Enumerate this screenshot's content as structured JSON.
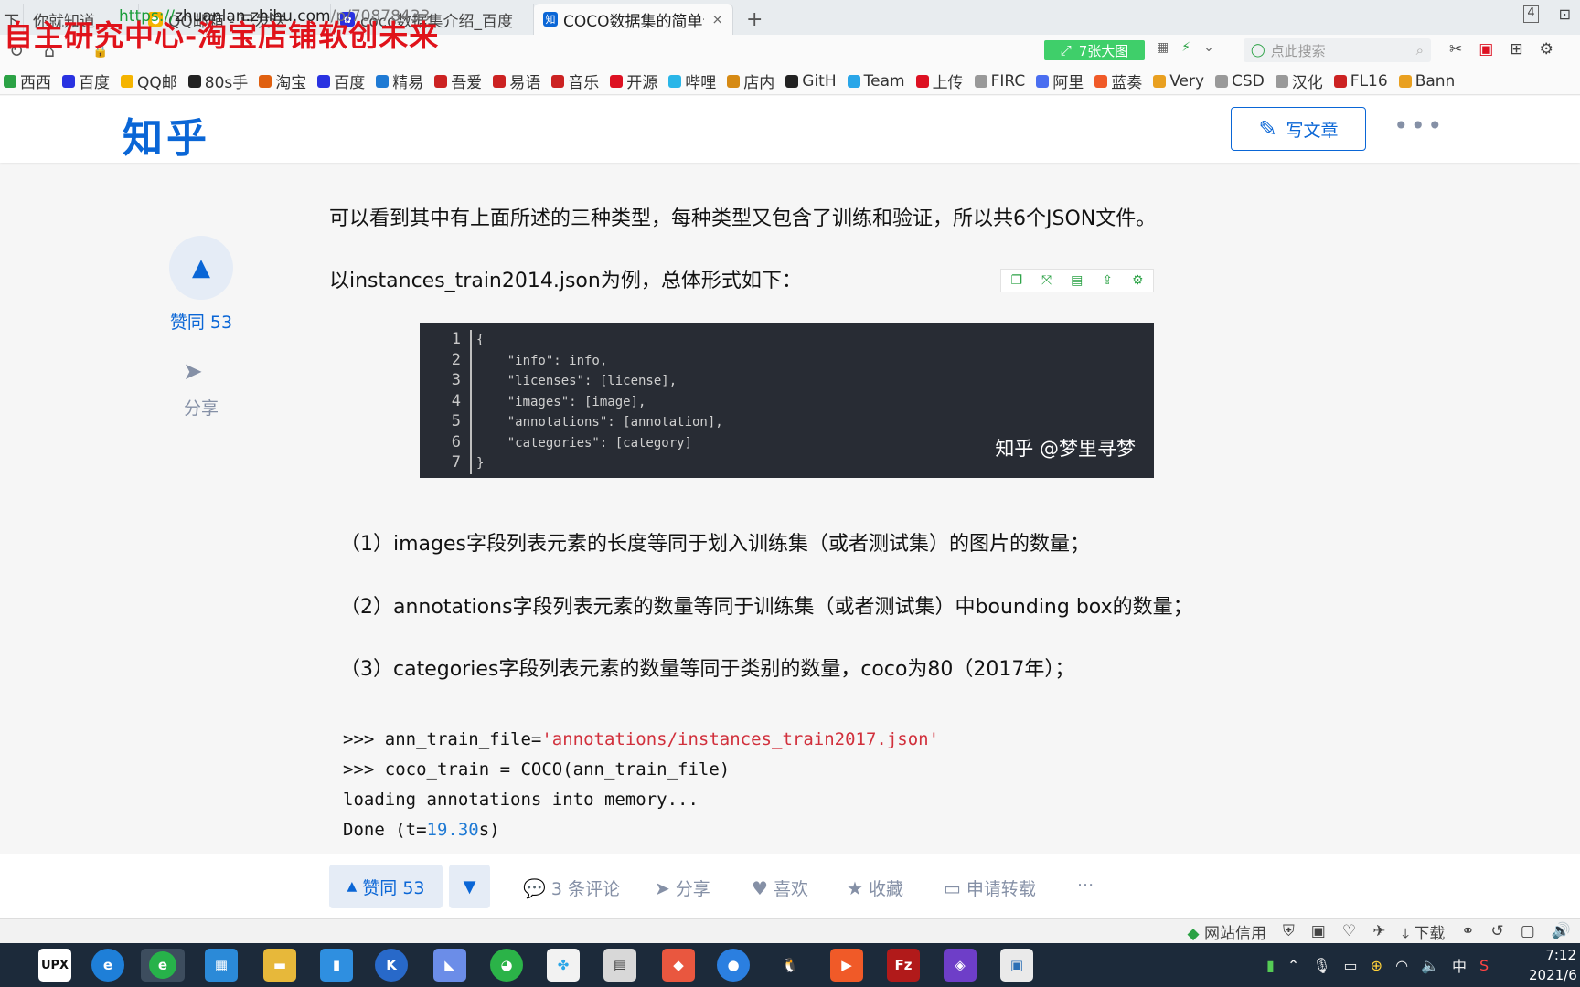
{
  "overlay_text": "自主研究中心-淘宝店铺软创未来",
  "tabs": [
    {
      "label": "下",
      "icon": "partial"
    },
    {
      "label": "你就知道",
      "icon": "partial"
    },
    {
      "label": "QQ邮箱 - 已发送",
      "icon": "qqmail"
    },
    {
      "label": "coco数据集介绍_百度",
      "icon": "baidu"
    },
    {
      "label": "COCO数据集的简单介",
      "icon": "zhihu",
      "close": "×"
    }
  ],
  "new_tab": "+",
  "window_controls": [
    "4",
    "⊡",
    "□",
    "✕"
  ],
  "address": {
    "scheme": "https://",
    "host": "zhuanlan.zhihu.com",
    "path": "/p/70878433",
    "image_count": "7张大图",
    "search_placeholder": "点此搜索"
  },
  "bookmarks": [
    "西西",
    "百度",
    "QQ邮",
    "80s手",
    "淘宝",
    "百度",
    "精易",
    "吾爱",
    "易语",
    "音乐",
    "开源",
    "哔哩",
    "店内",
    "GitH",
    "Team",
    "上传",
    "FIRC",
    "阿里",
    "蓝奏",
    "Very",
    "CSD",
    "汉化",
    "FL16",
    "Bann"
  ],
  "header": {
    "logo": "知乎",
    "write_label": "写文章",
    "more": "•••"
  },
  "side": {
    "vote_label": "赞同 53",
    "share_label": "分享"
  },
  "article": {
    "p1": "可以看到其中有上面所述的三种类型，每种类型又包含了训练和验证，所以共6个JSON文件。",
    "p2": "以instances_train2014.json为例，总体形式如下：",
    "code_image": {
      "line_numbers": [
        "1",
        "2",
        "3",
        "4",
        "5",
        "6",
        "7"
      ],
      "lines": [
        "{",
        "    \"info\": info,",
        "    \"licenses\": [license],",
        "    \"images\": [image],",
        "    \"annotations\": [annotation],",
        "    \"categories\": [category]",
        "}"
      ],
      "watermark": "知乎 @梦里寻梦"
    },
    "items": [
      "（1）images字段列表元素的长度等同于划入训练集（或者测试集）的图片的数量；",
      "（2）annotations字段列表元素的数量等同于训练集（或者测试集）中bounding box的数量；",
      "（3）categories字段列表元素的数量等同于类别的数量，coco为80（2017年）；"
    ],
    "code": {
      "l1_prefix": ">>> ann_train_file=",
      "l1_string": "'annotations/instances_train2017.json'",
      "l2": ">>> coco_train = COCO(ann_train_file)",
      "l3": "loading annotations into memory...",
      "l4_prefix": "Done (t=",
      "l4_number": "19.30",
      "l4_suffix": "s)"
    }
  },
  "actions": {
    "vote_up": "赞同 53",
    "comments": "3 条评论",
    "share": "分享",
    "like": "喜欢",
    "collect": "收藏",
    "repost": "申请转载",
    "more": "···"
  },
  "statusbar": {
    "site_credit": "网站信用",
    "download": "下载"
  },
  "taskbar": {
    "upx_label": "UPX",
    "clock_time": "7:12",
    "clock_date": "2021/6",
    "ime": "中"
  },
  "colors": {
    "zhihu_blue": "#0a66d6",
    "overlay_red": "#e0121a",
    "code_bg": "#282c34"
  }
}
